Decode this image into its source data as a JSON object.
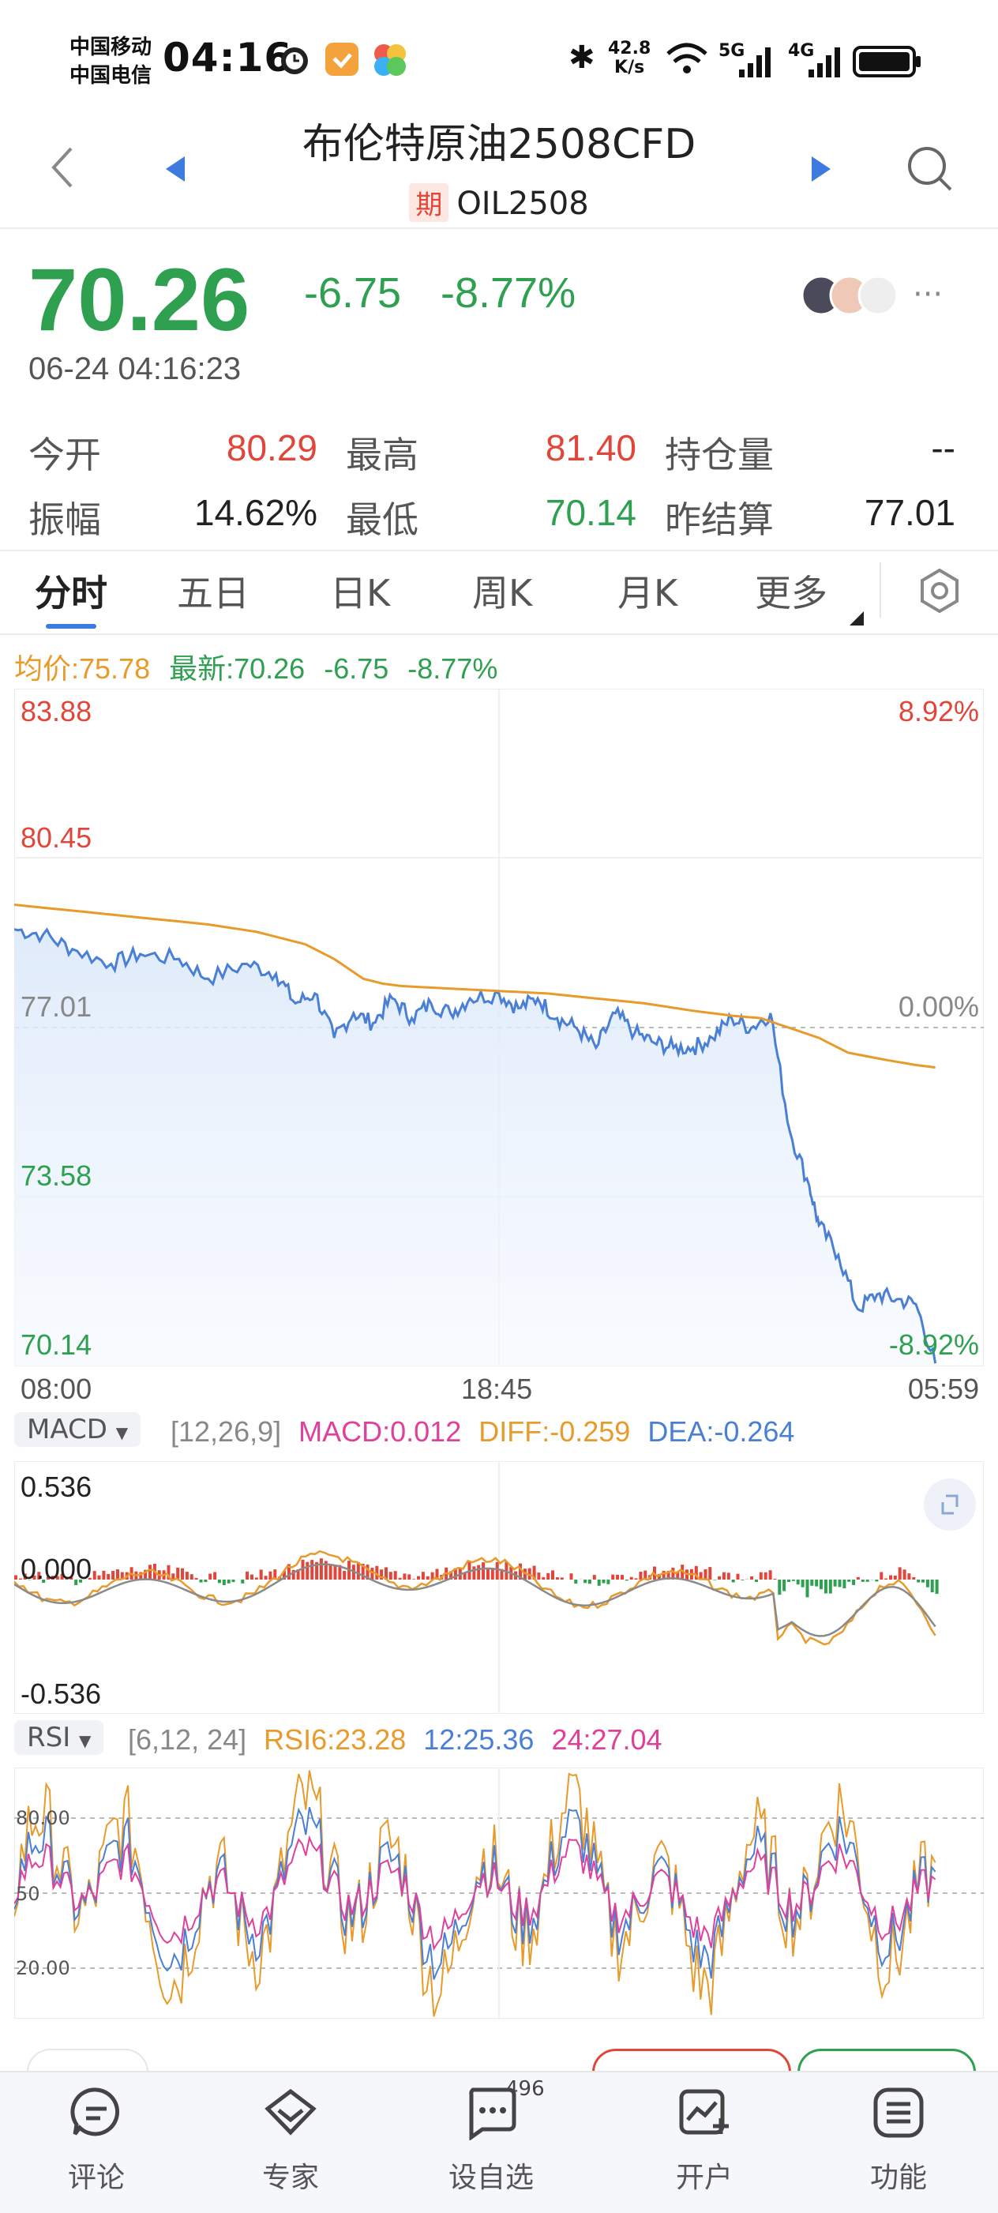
{
  "status_bar": {
    "carrier1": "中国移动",
    "carrier2": "中国电信",
    "time": "04:16",
    "net_speed_top": "42.8",
    "net_speed_bottom": "K/s",
    "net1": "5G",
    "net2": "4G"
  },
  "header": {
    "title": "布伦特原油2508CFD",
    "badge": "期",
    "code": "OIL2508"
  },
  "quote": {
    "price": "70.26",
    "change": "-6.75",
    "change_pct": "-8.77%",
    "timestamp": "06-24 04:16:23",
    "more": "···"
  },
  "stats": {
    "open_label": "今开",
    "open_value": "80.29",
    "high_label": "最高",
    "high_value": "81.40",
    "oi_label": "持仓量",
    "oi_value": "--",
    "amp_label": "振幅",
    "amp_value": "14.62%",
    "low_label": "最低",
    "low_value": "70.14",
    "settle_label": "昨结算",
    "settle_value": "77.01"
  },
  "tabs": [
    "分时",
    "五日",
    "日K",
    "周K",
    "月K",
    "更多"
  ],
  "chart_legend": {
    "avg": "均价:75.78",
    "latest": "最新:70.26",
    "chg": "-6.75",
    "pct": "-8.77%"
  },
  "chart_data": [
    {
      "type": "line",
      "title": "",
      "y_ticks_left": [
        "83.88",
        "80.45",
        "77.01",
        "73.58",
        "70.14"
      ],
      "y_ticks_right": [
        "8.92%",
        "0.00%",
        "-8.92%"
      ],
      "x_ticks": [
        "08:00",
        "18:45",
        "05:59"
      ],
      "ylim": [
        70.14,
        83.88
      ],
      "reference": 77.01,
      "series": [
        {
          "name": "最新",
          "color": "#4a7fd6",
          "x": [
            0,
            0.03,
            0.06,
            0.1,
            0.13,
            0.17,
            0.2,
            0.24,
            0.27,
            0.29,
            0.31,
            0.33,
            0.35,
            0.37,
            0.39,
            0.41,
            0.43,
            0.45,
            0.47,
            0.5,
            0.52,
            0.54,
            0.56,
            0.58,
            0.6,
            0.62,
            0.64,
            0.66,
            0.68,
            0.7,
            0.72,
            0.74,
            0.76,
            0.78,
            0.8,
            0.82,
            0.83,
            0.85,
            0.87,
            0.89,
            0.91,
            0.93,
            0.95
          ],
          "values": [
            79.0,
            78.9,
            78.6,
            78.3,
            78.5,
            78.4,
            78.0,
            78.3,
            78.1,
            77.5,
            77.7,
            76.8,
            77.3,
            77.1,
            77.6,
            77.2,
            77.5,
            77.3,
            77.6,
            77.7,
            77.4,
            77.6,
            77.2,
            77.0,
            76.6,
            77.3,
            76.9,
            76.7,
            76.6,
            76.6,
            76.8,
            77.2,
            77.0,
            77.3,
            74.9,
            73.8,
            73.0,
            72.4,
            71.3,
            71.6,
            71.5,
            71.4,
            70.2
          ]
        },
        {
          "name": "均价",
          "color": "#e89a2b",
          "x": [
            0,
            0.05,
            0.1,
            0.15,
            0.2,
            0.25,
            0.3,
            0.33,
            0.36,
            0.38,
            0.4,
            0.45,
            0.5,
            0.55,
            0.6,
            0.65,
            0.7,
            0.74,
            0.77,
            0.8,
            0.83,
            0.86,
            0.9,
            0.93,
            0.95
          ],
          "values": [
            79.5,
            79.4,
            79.3,
            79.2,
            79.1,
            78.95,
            78.7,
            78.4,
            78.0,
            77.9,
            77.85,
            77.8,
            77.75,
            77.7,
            77.6,
            77.5,
            77.35,
            77.25,
            77.2,
            77.0,
            76.8,
            76.5,
            76.35,
            76.25,
            76.2
          ]
        }
      ]
    },
    {
      "type": "bar",
      "title": "MACD",
      "params": "[12,26,9]",
      "macd_label": "MACD:0.012",
      "diff_label": "DIFF:-0.259",
      "dea_label": "DEA:-0.264",
      "y_ticks": [
        "0.536",
        "0.000",
        "-0.536"
      ],
      "ylim": [
        -0.536,
        0.536
      ]
    },
    {
      "type": "line",
      "title": "RSI",
      "params": "[6,12, 24]",
      "rsi6_label": "RSI6:23.28",
      "rsi12_label": "12:25.36",
      "rsi24_label": "24:27.04",
      "y_ticks": [
        "80.00",
        "50",
        "20.00"
      ],
      "ylim": [
        0,
        100
      ]
    }
  ],
  "bottom_nav": [
    {
      "label": "评论",
      "icon": "comment-icon"
    },
    {
      "label": "专家",
      "icon": "expert-icon"
    },
    {
      "label": "设自选",
      "icon": "watchlist-icon",
      "badge": "496"
    },
    {
      "label": "开户",
      "icon": "open-account-icon"
    },
    {
      "label": "功能",
      "icon": "menu-icon"
    }
  ],
  "colors": {
    "up": "#e0463a",
    "down": "#2ea050",
    "price_line": "#4a7fd6",
    "avg_line": "#e89a2b",
    "rsi6": "#e89a2b",
    "rsi12": "#4a7fd6",
    "rsi24": "#e0409a"
  }
}
